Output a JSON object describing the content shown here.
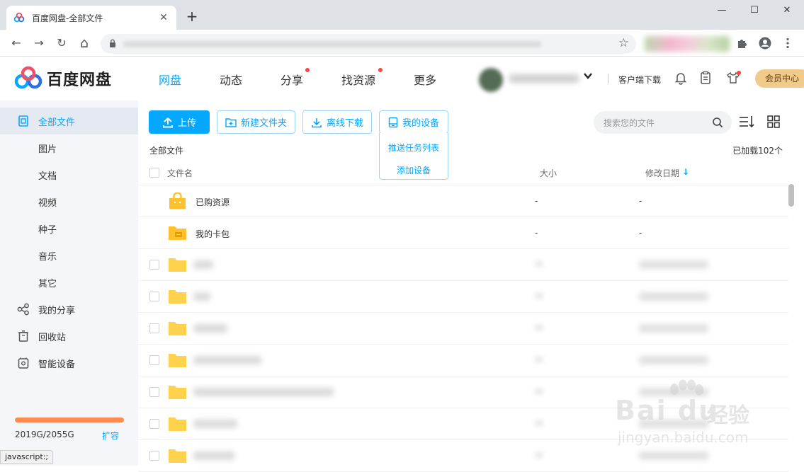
{
  "browser": {
    "tab_title": "百度网盘-全部文件",
    "tab_close": "✕",
    "new_tab": "+",
    "minimize": "—",
    "maximize": "☐",
    "close": "✕",
    "back": "←",
    "forward": "→",
    "reload": "↻",
    "home": "⌂",
    "bookmark_star": "☆",
    "status_text": "javascript:;"
  },
  "header": {
    "logo_text": "百度网盘",
    "nav": [
      {
        "label": "网盘",
        "active": true
      },
      {
        "label": "动态"
      },
      {
        "label": "分享",
        "dot": true
      },
      {
        "label": "找资源",
        "dot": true
      },
      {
        "label": "更多"
      }
    ],
    "client_download": "客户端下载",
    "vip_label": "会员中心"
  },
  "sidebar": {
    "items": [
      {
        "label": "全部文件",
        "icon": "all-files-icon",
        "active": true
      },
      {
        "label": "图片"
      },
      {
        "label": "文档"
      },
      {
        "label": "视频"
      },
      {
        "label": "种子"
      },
      {
        "label": "音乐"
      },
      {
        "label": "其它"
      },
      {
        "label": "我的分享",
        "icon": "share-icon"
      },
      {
        "label": "回收站",
        "icon": "trash-icon"
      },
      {
        "label": "智能设备",
        "icon": "smart-device-icon"
      }
    ],
    "quota": "2019G/2055G",
    "quota_used_fraction": 0.982,
    "expand": "扩容"
  },
  "toolbar": {
    "upload": "上传",
    "new_folder": "新建文件夹",
    "offline_download": "离线下载",
    "my_devices": "我的设备",
    "dropdown": [
      "推送任务列表",
      "添加设备"
    ],
    "search_placeholder": "搜索您的文件"
  },
  "list": {
    "breadcrumb": "全部文件",
    "loaded_count": "已加载102个",
    "columns": {
      "name": "文件名",
      "size": "大小",
      "modified": "修改日期"
    },
    "sort_arrow": "↓",
    "rows": [
      {
        "name": "已购资源",
        "size": "-",
        "modified": "-"
      },
      {
        "name": "我的卡包",
        "size": "-",
        "modified": "-"
      }
    ]
  },
  "watermark": {
    "brand": "Bai du",
    "suffix": "经验",
    "url": "jingyan.baidu.com"
  },
  "colors": {
    "accent": "#06a7ff",
    "quota_bar": "#ff8a52",
    "vip_bg": "#f1cb8c",
    "folder": "#ffd24d"
  }
}
